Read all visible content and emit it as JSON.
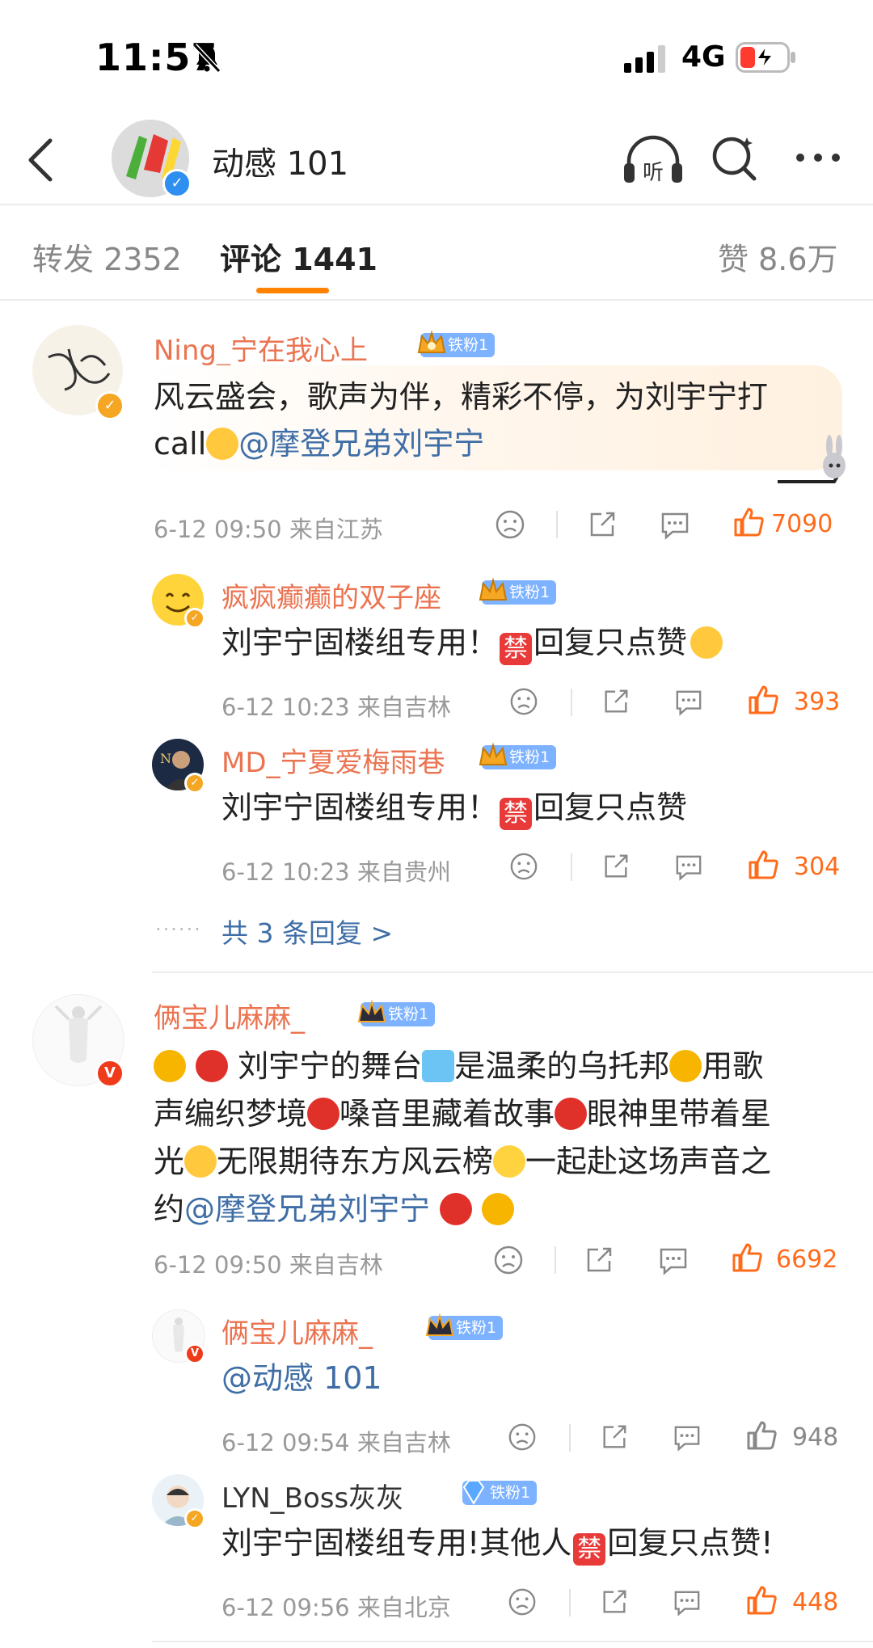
{
  "status": {
    "time": "11:57",
    "network": "4G"
  },
  "header": {
    "title": "动感 101"
  },
  "tabs": [
    {
      "label": "转发 2352"
    },
    {
      "label": "评论 1441"
    },
    {
      "label": "赞 8.6万"
    }
  ],
  "comments": [
    {
      "user": "Ning_宁在我心上",
      "badge": "铁粉1",
      "text1": "风云盛会，歌声为伴，精彩不停，为刘宇宁打",
      "text2a": "call",
      "mention": "@摩登兄弟刘宇宁",
      "meta": "6-12 09:50  来自江苏",
      "likes": "7090",
      "replies": [
        {
          "user": "疯疯癫癫的双子座",
          "badge": "铁粉1",
          "text_a": "刘宇宁固楼组专用！",
          "ban": "禁",
          "text_b": "回复只点赞",
          "meta": "6-12 10:23  来自吉林",
          "likes": "393"
        },
        {
          "user": "MD_宁夏爱梅雨巷",
          "badge": "铁粉1",
          "text_a": "刘宇宁固楼组专用！",
          "ban": "禁",
          "text_b": "回复只点赞",
          "meta": "6-12 10:23  来自贵州",
          "likes": "304"
        }
      ],
      "more_replies": "共 3 条回复 >"
    },
    {
      "user": "俩宝儿麻麻_",
      "badge": "铁粉1",
      "line1": "刘宇宁的舞台",
      "line1b": "是温柔的乌托邦",
      "line1c": "用歌",
      "line2": "声编织梦境",
      "line2b": "嗓音里藏着故事",
      "line2c": "眼神里带着星",
      "line3": "光",
      "line3b": "无限期待东方风云榜",
      "line3c": "一起赴这场声音之",
      "line4": "约",
      "mention": "@摩登兄弟刘宇宁",
      "meta": "6-12 09:50  来自吉林",
      "likes": "6692",
      "replies": [
        {
          "user": "俩宝儿麻麻_",
          "badge": "铁粉1",
          "text": "@动感 101",
          "meta": "6-12 09:54  来自吉林",
          "likes": "948"
        },
        {
          "user": "LYN_Boss灰灰",
          "badge": "铁粉1",
          "text_a": "刘宇宁固楼组专用!其他人",
          "ban": "禁",
          "text_b": "回复只点赞!",
          "meta": "6-12 09:56  来自北京",
          "likes": "448"
        }
      ]
    }
  ],
  "colors": {
    "accent": "#ff8200",
    "username": "#eb7350",
    "link": "#3f6ea6",
    "like": "#ff6b1a"
  }
}
